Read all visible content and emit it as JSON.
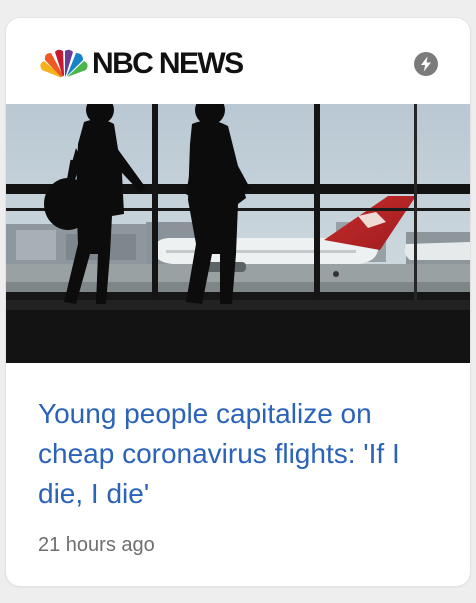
{
  "card": {
    "source": {
      "name": "NBC NEWS",
      "logo_icon": "nbc-peacock-logo",
      "badge_icon": "amp-lightning-icon",
      "badge_color": "#7b7b7b"
    },
    "image": {
      "icon": "news-photo-airport-travelers"
    },
    "headline": "Young people capitalize on cheap coronavirus flights: 'If I die, I die'",
    "headline_color": "#2a63b8",
    "timestamp": "21 hours ago"
  }
}
